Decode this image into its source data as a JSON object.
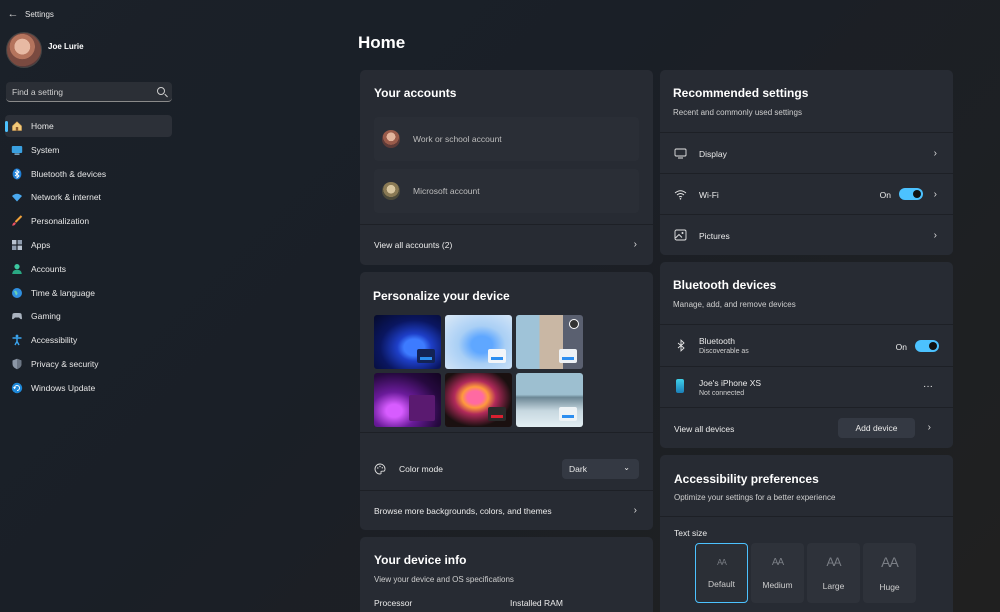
{
  "window": {
    "title": "Settings"
  },
  "user": {
    "name": "Joe Lurie"
  },
  "search": {
    "placeholder": "Find a setting"
  },
  "sidebar": {
    "items": [
      {
        "label": "Home",
        "icon": "home-icon"
      },
      {
        "label": "System",
        "icon": "system-icon"
      },
      {
        "label": "Bluetooth & devices",
        "icon": "bluetooth-icon"
      },
      {
        "label": "Network & internet",
        "icon": "wifi-icon"
      },
      {
        "label": "Personalization",
        "icon": "brush-icon"
      },
      {
        "label": "Apps",
        "icon": "apps-icon"
      },
      {
        "label": "Accounts",
        "icon": "person-icon"
      },
      {
        "label": "Time & language",
        "icon": "globe-icon"
      },
      {
        "label": "Gaming",
        "icon": "gamepad-icon"
      },
      {
        "label": "Accessibility",
        "icon": "accessibility-icon"
      },
      {
        "label": "Privacy & security",
        "icon": "shield-icon"
      },
      {
        "label": "Windows Update",
        "icon": "update-icon"
      }
    ],
    "active": "Home"
  },
  "main": {
    "title": "Home"
  },
  "accounts": {
    "title": "Your accounts",
    "items": [
      {
        "label": "Work or school account"
      },
      {
        "label": "Microsoft account"
      }
    ],
    "view_all": "View all accounts (2)"
  },
  "personalize": {
    "title": "Personalize your device",
    "color_mode_label": "Color mode",
    "color_mode_value": "Dark",
    "browse_label": "Browse more backgrounds, colors, and themes"
  },
  "device_info": {
    "title": "Your device info",
    "subtitle": "View your device and OS specifications",
    "processor_label": "Processor",
    "ram_label": "Installed RAM"
  },
  "recommended": {
    "title": "Recommended settings",
    "subtitle": "Recent and commonly used settings",
    "items": [
      {
        "label": "Display",
        "icon": "monitor-icon"
      },
      {
        "label": "Wi-Fi",
        "icon": "wifi-icon",
        "state": "On"
      },
      {
        "label": "Pictures",
        "icon": "picture-icon"
      }
    ]
  },
  "bluetooth": {
    "title": "Bluetooth devices",
    "subtitle": "Manage, add, and remove devices",
    "bt_label": "Bluetooth",
    "bt_sub": "Discoverable as",
    "bt_state": "On",
    "device_name": "Joe's iPhone XS",
    "device_status": "Not connected",
    "more": "···",
    "view_all": "View all devices",
    "add_device": "Add device"
  },
  "accessibility": {
    "title": "Accessibility preferences",
    "subtitle": "Optimize your settings for a better experience",
    "text_size_label": "Text size",
    "sizes": [
      {
        "label": "Default",
        "glyph": "AA"
      },
      {
        "label": "Medium",
        "glyph": "AA"
      },
      {
        "label": "Large",
        "glyph": "AA"
      },
      {
        "label": "Huge",
        "glyph": "AA"
      }
    ],
    "selected": "Default"
  },
  "colors": {
    "accent": "#4cc2ff",
    "card": "#272b33",
    "background": "#1b2129"
  }
}
